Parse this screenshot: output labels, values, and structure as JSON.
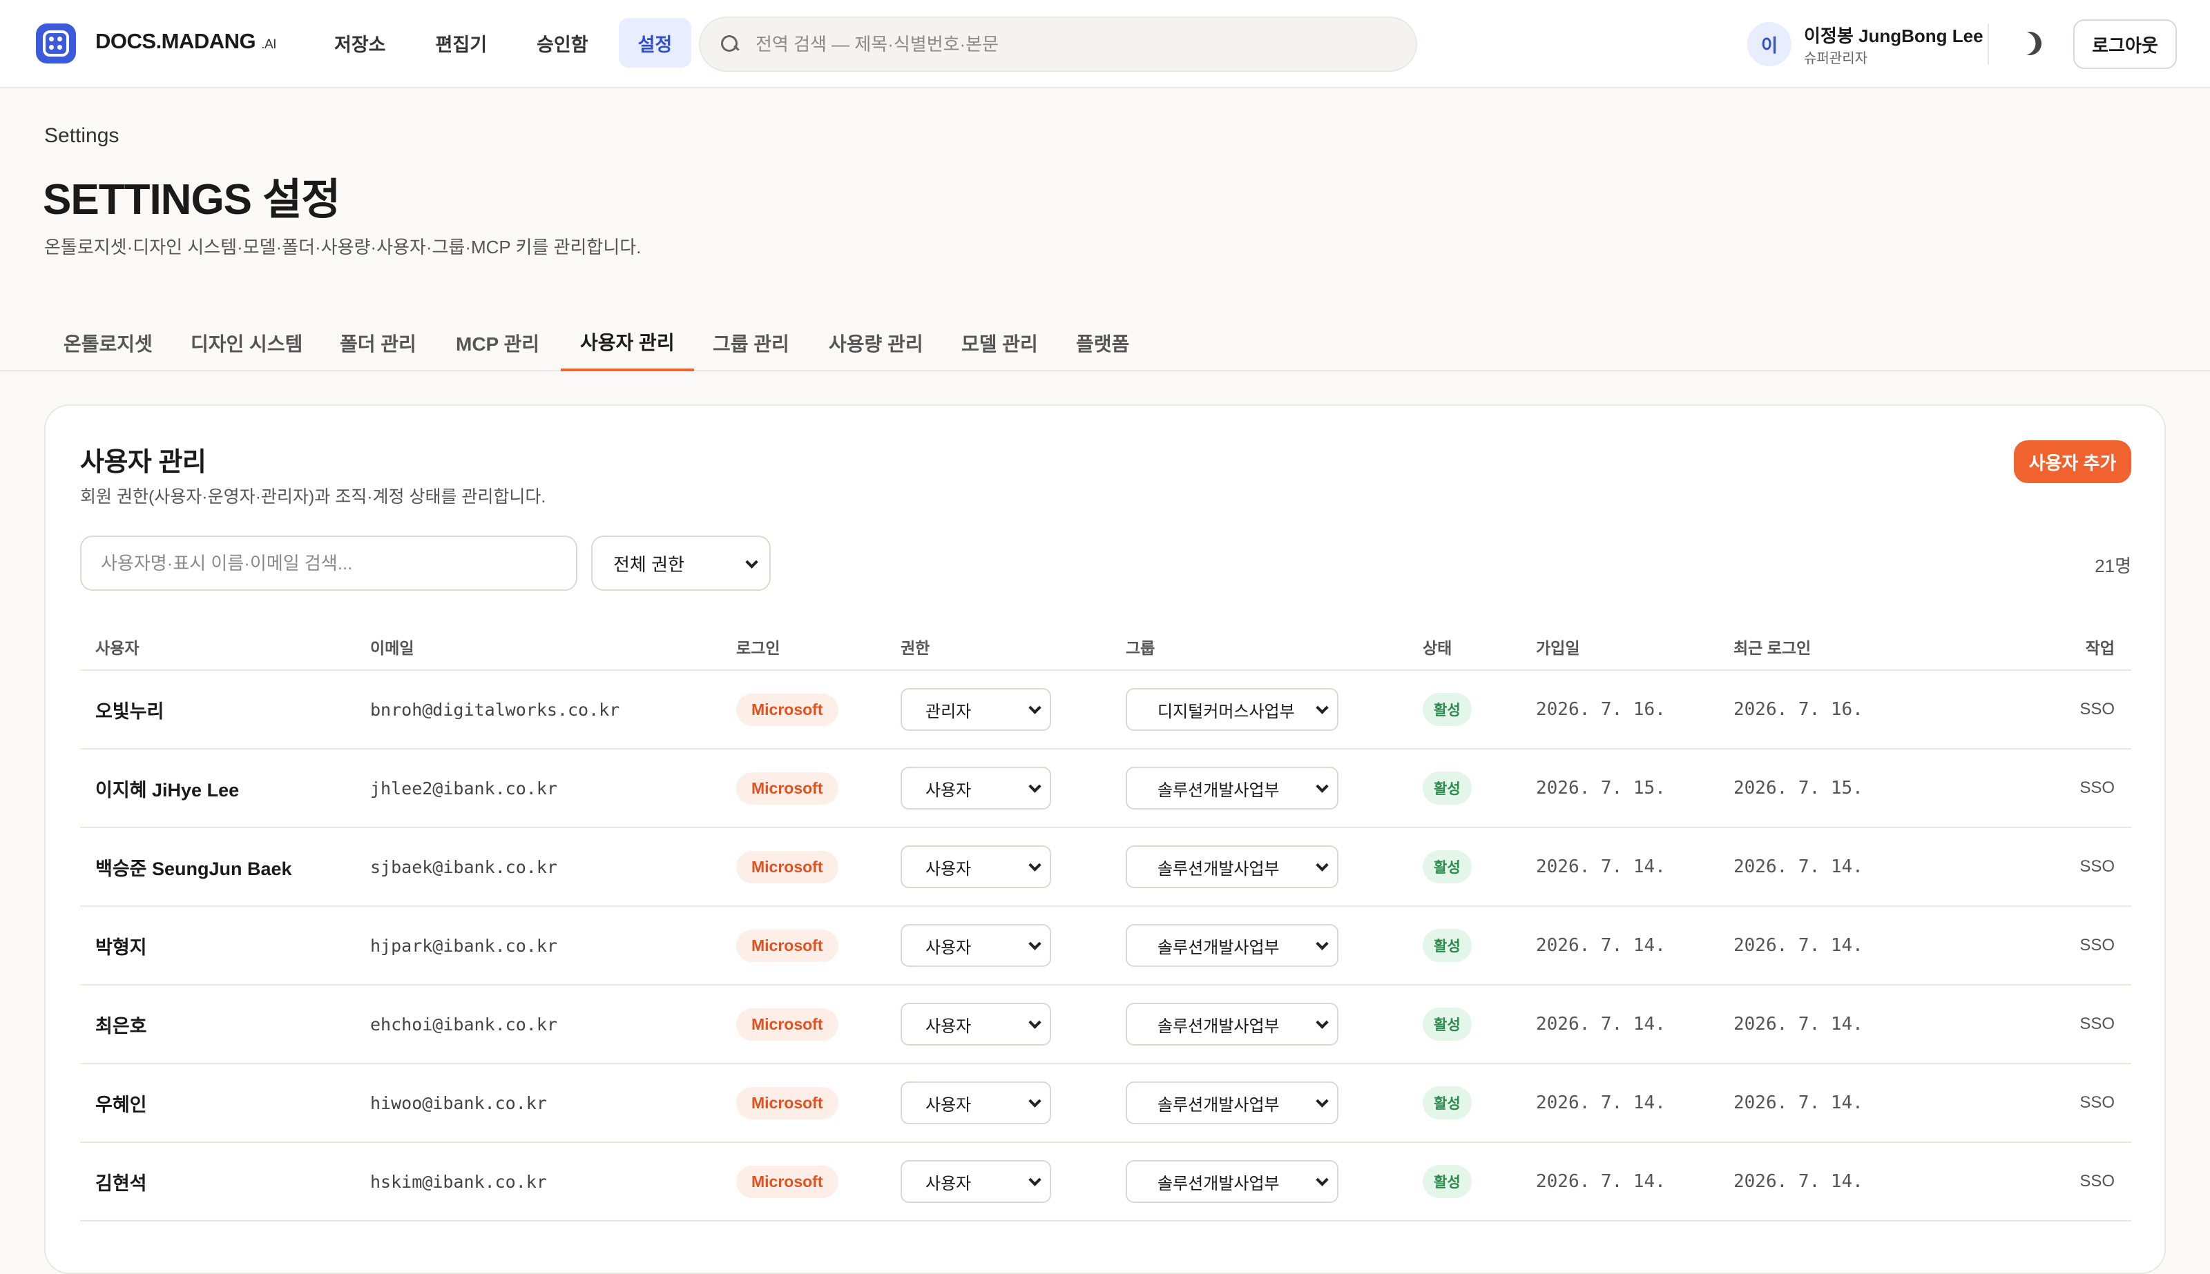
{
  "app": {
    "brand": "DOCS.MADANG",
    "brand_suffix": ".AI",
    "logo_icon": "grid-dots-logo-icon"
  },
  "nav": [
    {
      "label": "저장소",
      "active": false
    },
    {
      "label": "편집기",
      "active": false
    },
    {
      "label": "승인함",
      "active": false
    },
    {
      "label": "설정",
      "active": true
    }
  ],
  "search": {
    "placeholder": "전역 검색 — 제목·식별번호·본문"
  },
  "user": {
    "initial": "이",
    "name": "이정봉 JungBong Lee",
    "role": "슈퍼관리자"
  },
  "header_actions": {
    "theme_icon": "moon-icon",
    "logout_label": "로그아웃"
  },
  "page": {
    "breadcrumb": "Settings",
    "title": "SETTINGS 설정",
    "description": "온톨로지셋·디자인 시스템·모델·폴더·사용량·사용자·그룹·MCP 키를 관리합니다."
  },
  "tabs": [
    {
      "label": "온톨로지셋",
      "active": false
    },
    {
      "label": "디자인 시스템",
      "active": false
    },
    {
      "label": "폴더 관리",
      "active": false
    },
    {
      "label": "MCP 관리",
      "active": false
    },
    {
      "label": "사용자 관리",
      "active": true
    },
    {
      "label": "그룹 관리",
      "active": false
    },
    {
      "label": "사용량 관리",
      "active": false
    },
    {
      "label": "모델 관리",
      "active": false
    },
    {
      "label": "플랫폼",
      "active": false
    }
  ],
  "users_panel": {
    "title": "사용자 관리",
    "description": "회원 권한(사용자·운영자·관리자)과 조직·계정 상태를 관리합니다.",
    "add_button": "사용자 추가",
    "filter_placeholder": "사용자명·표시 이름·이메일 검색...",
    "role_filter": "전체 권한",
    "count": "21명",
    "columns": [
      "사용자",
      "이메일",
      "로그인",
      "권한",
      "그룹",
      "상태",
      "가입일",
      "최근 로그인",
      "작업"
    ],
    "rows": [
      {
        "name": "오빛누리",
        "email": "bnroh@digitalworks.co.kr",
        "login": "Microsoft",
        "role": "관리자",
        "group": "디지털커머스사업부",
        "status": "활성",
        "joined": "2026. 7. 16.",
        "last_login": "2026. 7. 16.",
        "action": "SSO"
      },
      {
        "name": "이지혜 JiHye Lee",
        "email": "jhlee2@ibank.co.kr",
        "login": "Microsoft",
        "role": "사용자",
        "group": "솔루션개발사업부",
        "status": "활성",
        "joined": "2026. 7. 15.",
        "last_login": "2026. 7. 15.",
        "action": "SSO"
      },
      {
        "name": "백승준 SeungJun Baek",
        "email": "sjbaek@ibank.co.kr",
        "login": "Microsoft",
        "role": "사용자",
        "group": "솔루션개발사업부",
        "status": "활성",
        "joined": "2026. 7. 14.",
        "last_login": "2026. 7. 14.",
        "action": "SSO"
      },
      {
        "name": "박형지",
        "email": "hjpark@ibank.co.kr",
        "login": "Microsoft",
        "role": "사용자",
        "group": "솔루션개발사업부",
        "status": "활성",
        "joined": "2026. 7. 14.",
        "last_login": "2026. 7. 14.",
        "action": "SSO"
      },
      {
        "name": "최은호",
        "email": "ehchoi@ibank.co.kr",
        "login": "Microsoft",
        "role": "사용자",
        "group": "솔루션개발사업부",
        "status": "활성",
        "joined": "2026. 7. 14.",
        "last_login": "2026. 7. 14.",
        "action": "SSO"
      },
      {
        "name": "우혜인",
        "email": "hiwoo@ibank.co.kr",
        "login": "Microsoft",
        "role": "사용자",
        "group": "솔루션개발사업부",
        "status": "활성",
        "joined": "2026. 7. 14.",
        "last_login": "2026. 7. 14.",
        "action": "SSO"
      },
      {
        "name": "김현석",
        "email": "hskim@ibank.co.kr",
        "login": "Microsoft",
        "role": "사용자",
        "group": "솔루션개발사업부",
        "status": "활성",
        "joined": "2026. 7. 14.",
        "last_login": "2026. 7. 14.",
        "action": "SSO"
      }
    ]
  },
  "colors": {
    "accent": "#f0622e",
    "nav_active_bg": "#e8edff",
    "nav_active_text": "#2f4fd0",
    "status_active": "#2e8b4e"
  }
}
